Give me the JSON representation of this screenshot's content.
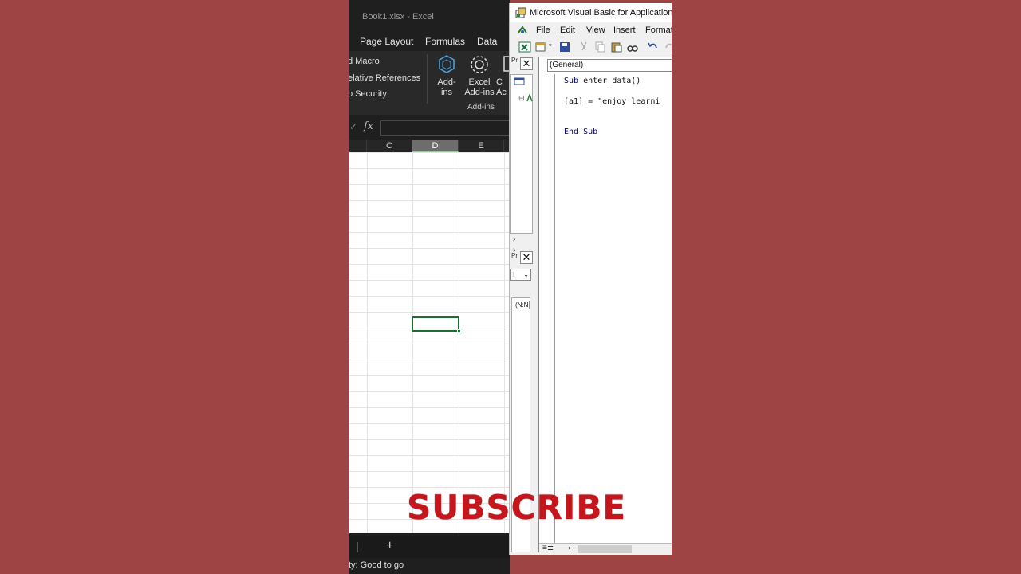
{
  "excel": {
    "title": "Book1.xlsx  -  Excel",
    "tabs": [
      "Page Layout",
      "Formulas",
      "Data"
    ],
    "ribbon": {
      "code_items": [
        "d Macro",
        "elative References",
        "o Security"
      ],
      "addins_button": "Add-\nins",
      "excel_addins_button": "Excel\nAdd-ins",
      "partial_button": "C\nAc",
      "group_label": "Add-ins"
    },
    "formula_bar": {
      "fx_label": "fx",
      "value": ""
    },
    "columns": [
      "C",
      "D",
      "E"
    ],
    "selected_column": "D",
    "sheet_add": "+",
    "status": "ty: Good to go"
  },
  "vba": {
    "title": "Microsoft Visual Basic for Applications",
    "menu": [
      "File",
      "Edit",
      "View",
      "Insert",
      "Format"
    ],
    "project_header": "Pr",
    "properties_header": "Pr",
    "properties_combo": "I",
    "properties_item": "(N:N",
    "code_combo": "(General)",
    "code_lines": [
      {
        "kw": "Sub",
        "rest": " enter_data()"
      },
      {
        "kw": "",
        "rest": "[a1] = \"enjoy learni"
      },
      {
        "kw": "End Sub",
        "rest": ""
      }
    ]
  },
  "overlay": {
    "subscribe": "SUBSCRIBE"
  },
  "colors": {
    "background": "#9e4444",
    "excel_dark": "#1f1f1f",
    "selection_green": "#1e6b34",
    "subscribe_red": "#c4161c"
  }
}
